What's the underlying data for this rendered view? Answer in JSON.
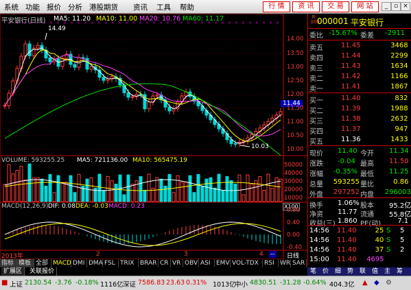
{
  "menu": [
    "系统",
    "功能",
    "报价",
    "分析",
    "港股期货",
    "资讯",
    "工具",
    "帮助"
  ],
  "right_buttons": [
    "行 情",
    "资 讯",
    "交 易",
    "网 站"
  ],
  "chart": {
    "title": "平安银行(日线)",
    "ma5": "MA5: 11.20",
    "ma10": "MA10: 11.00",
    "ma20": "MA20: 10.76",
    "ma60": "MA60: 11.17",
    "high_marker": "14.49",
    "low_marker": "10.03",
    "current_price_tag": "11.44",
    "price_axis": [
      "14.00",
      "13.50",
      "13.00",
      "12.50",
      "12.00",
      "11.50",
      "11.00",
      "10.50",
      "10.00"
    ],
    "volume_label": "VOLUME: 593255.25",
    "vol_ma5": "MA5: 721136.00",
    "vol_ma10": "MA10: 565475.19",
    "volume_axis": [
      "50000",
      "40000",
      "30000",
      "20000",
      "10000"
    ],
    "volume_unit": "X100",
    "macd_label": "MACD(12,26,9)",
    "dif": "DIF: 0.08",
    "dea": "DEA: -0.03",
    "macd": "MACD: 0.23",
    "macd_axis": [
      "0.80",
      "0.40",
      "0.00",
      "-0.40"
    ],
    "x_labels": [
      "2013年",
      "2",
      "3",
      "4"
    ],
    "period": "日线",
    "colors": {
      "up": "#ff3c3c",
      "down": "#00d8d8",
      "ma5": "#ffffff",
      "ma10": "#ffff00",
      "ma20": "#ff40ff",
      "ma60": "#00e600"
    }
  },
  "tabs": [
    "指标",
    "模板",
    "全部",
    "MACD",
    "DMI",
    "DMA",
    "FSL",
    "TRIX",
    "BRAR",
    "CR",
    "VR",
    "OBV",
    "ASI",
    "EMV",
    "VOL-TDX",
    "RSI",
    "WR",
    "SAR"
  ],
  "bottom_tabs": [
    "扩展区",
    "关联报价"
  ],
  "quote": {
    "code": "000001",
    "name": "平安银行",
    "badge": "R 300",
    "weibi_label": "委比",
    "weibi": "-15.67%",
    "weicha_label": "委差",
    "weicha": "-2911",
    "asks": [
      {
        "label": "卖五",
        "price": "11.45",
        "vol": "3468"
      },
      {
        "label": "卖四",
        "price": "11.44",
        "vol": "2299"
      },
      {
        "label": "卖三",
        "price": "11.43",
        "vol": "1634"
      },
      {
        "label": "卖二",
        "price": "11.42",
        "vol": "1166"
      },
      {
        "label": "卖一",
        "price": "11.41",
        "vol": "1867"
      }
    ],
    "bids": [
      {
        "label": "买一",
        "price": "11.40",
        "vol": "832"
      },
      {
        "label": "买二",
        "price": "11.39",
        "vol": "1988"
      },
      {
        "label": "买三",
        "price": "11.38",
        "vol": "2632"
      },
      {
        "label": "买四",
        "price": "11.37",
        "vol": "947"
      },
      {
        "label": "买五",
        "price": "11.36",
        "vol": "1433"
      }
    ],
    "stats": [
      [
        "现价",
        "11.40",
        "今开",
        "11.34"
      ],
      [
        "涨跌",
        "-0.04",
        "最高",
        "11.50"
      ],
      [
        "涨幅",
        "-0.35%",
        "最低",
        "11.25"
      ],
      [
        "总量",
        "593255",
        "量比",
        "0.86"
      ],
      [
        "外盘",
        "297252",
        "内盘",
        "296003"
      ]
    ],
    "stats2": [
      [
        "换手",
        "1.06%",
        "股本",
        "95.2亿"
      ],
      [
        "净资",
        "11.77",
        "流通",
        "55.8亿"
      ],
      [
        "收益(三)",
        "1.860",
        "PE(动)",
        "7.1"
      ]
    ],
    "ticks": [
      {
        "time": "14:56",
        "price": "11.40",
        "vol": "25",
        "dir": "S",
        "n": "5"
      },
      {
        "time": "14:56",
        "price": "11.40",
        "vol": "40",
        "dir": "S",
        "n": "5"
      },
      {
        "time": "14:56",
        "price": "11.40",
        "vol": "37",
        "dir": "S",
        "n": "2"
      },
      {
        "time": "15:00",
        "price": "11.40",
        "vol": "4695",
        "dir": "",
        "n": ""
      }
    ],
    "right_tabs": [
      "笔",
      "价",
      "细",
      "势",
      "联",
      "值",
      "主",
      "筹"
    ]
  },
  "status": {
    "sh_label": "上证",
    "sh": "2130.54",
    "sh_chg": "-3.76",
    "sh_pct": "-0.18%",
    "sh_amt": "1116亿",
    "sz_label": "深证",
    "sz": "7586.83",
    "sz_chg": "23.63",
    "sz_pct": "0.31%",
    "sz_amt": "1013亿",
    "zx_label": "中小",
    "zx": "4830.51",
    "zx_chg": "-31.28",
    "zx_pct": "-0.64%",
    "zx_amt": "404.3亿"
  }
}
